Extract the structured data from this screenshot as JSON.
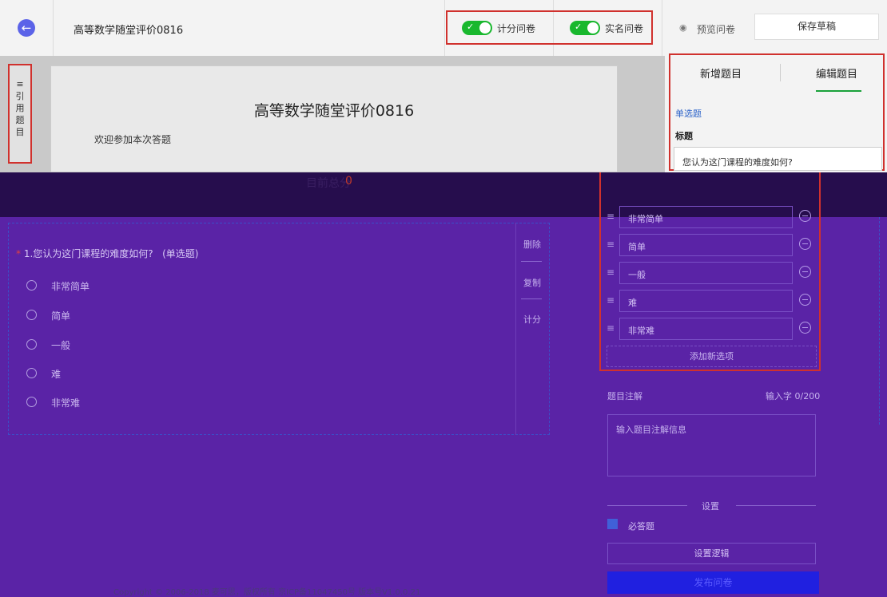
{
  "header": {
    "survey_title": "高等数学随堂评价0816",
    "toggles": [
      {
        "label": "计分问卷",
        "on": true
      },
      {
        "label": "实名问卷",
        "on": true
      }
    ],
    "preview_label": "预览问卷",
    "save_draft_label": "保存草稿"
  },
  "side_tab": {
    "chars": [
      "引",
      "用",
      "题",
      "目"
    ]
  },
  "form_header": {
    "title": "高等数学随堂评价0816",
    "welcome": "欢迎参加本次答题",
    "score_label": "目前总分",
    "score_value": "0"
  },
  "question": {
    "required_mark": "*",
    "text": "1.您认为这门课程的难度如何?",
    "type_tag": "(单选题)",
    "options": [
      "非常简单",
      "简单",
      "一般",
      "难",
      "非常难"
    ],
    "actions": [
      "删除",
      "复制",
      "计分"
    ]
  },
  "editor": {
    "tabs": [
      "新增题目",
      "编辑题目"
    ],
    "active_tab": "编辑题目",
    "question_type": "单选题",
    "title_label": "标题",
    "title_value": "您认为这门课程的难度如何?",
    "option_values": [
      "非常简单",
      "简单",
      "一般",
      "难",
      "非常难"
    ],
    "add_option_label": "添加新选项",
    "note_label": "题目注解",
    "note_count": "输入字 0/200",
    "note_placeholder": "输入题目注解信息",
    "settings_label": "设置",
    "required_label": "必答题",
    "required_checked": true,
    "logic_label": "设置逻辑",
    "publish_label": "发布问卷"
  },
  "footer": {
    "copyright": "Copyright © 2006-2018 麦可思，版权所有 京ICP备11047450号 版本号V1.0.0.21"
  },
  "colors": {
    "toggle_on": "#19b82e",
    "highlight_border": "#d0312d",
    "overlay_purple": "#5a23a6",
    "accent_blue": "#5b63e8"
  }
}
